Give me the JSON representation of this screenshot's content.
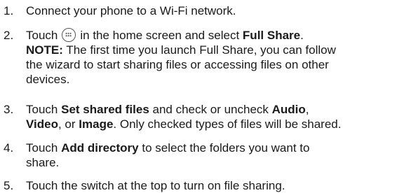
{
  "steps": [
    {
      "number": "1.",
      "text": "Connect your phone to a Wi-Fi network."
    },
    {
      "number": "2.",
      "pre": "Touch",
      "icon": "apps-grid-icon",
      "mid": "in the home screen and select",
      "bold1": "Full Share",
      "post": ".",
      "note_label": "NOTE:",
      "note_line1": "The first time you launch Full Share, you can follow",
      "note_line2": "the wizard to start sharing files or accessing files on other",
      "note_line3": "devices."
    },
    {
      "number": "3.",
      "pre": "Touch",
      "bold1": "Set shared files",
      "mid1": "and check or uncheck",
      "bold2": "Audio",
      "comma1": ",",
      "bold3": "Video",
      "mid2": ", or",
      "bold4": "Image",
      "post": ". Only checked types of files will be shared."
    },
    {
      "number": "4.",
      "pre": "Touch",
      "bold1": "Add directory",
      "line1_post": "to select the folders you want to",
      "line2": "share."
    },
    {
      "number": "5.",
      "text": "Touch the switch at the top to turn on file sharing."
    }
  ]
}
